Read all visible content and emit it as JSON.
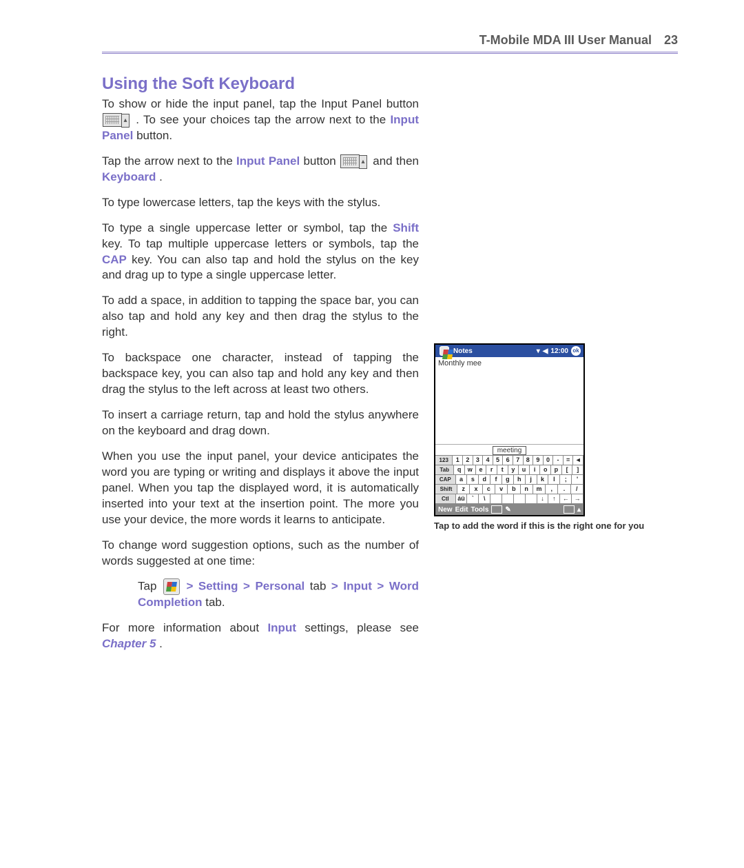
{
  "header": {
    "title": "T-Mobile MDA III User Manual",
    "page_number": "23"
  },
  "section": {
    "title": "Using the Soft Keyboard"
  },
  "para1": {
    "a": "To show or hide the input panel, tap the Input Panel button ",
    "b": ". To see your choices tap the arrow next to the ",
    "kw1": "Input Panel",
    "c": " button."
  },
  "para2": {
    "a": "Tap the arrow next to the ",
    "kw1": "Input Panel",
    "b": " button ",
    "c": " and then ",
    "kw2": "Keyboard",
    "d": "."
  },
  "para3": "To type lowercase letters, tap the keys with the stylus.",
  "para4": {
    "a": "To type a single uppercase letter or symbol, tap the ",
    "kw1": "Shift",
    "b": " key. To tap multiple uppercase letters or symbols, tap the ",
    "kw2": "CAP",
    "c": " key. You can also tap and hold the stylus on the key and drag up to type a single uppercase letter."
  },
  "para5": "To add a space, in addition to tapping the space bar, you can also tap and hold any key and then drag the stylus to the right.",
  "para6": "To backspace one character, instead of tapping the backspace key, you can also tap and hold any key and then drag the stylus to the left across at least two others.",
  "para7": "To insert a carriage return, tap and hold the stylus anywhere on the keyboard and drag down.",
  "para8": "When you use the input panel, your device anticipates the word you are typing or writing and displays it above the input panel. When you tap the displayed word, it is automatically inserted into your text at the insertion point. The more you use your device, the more words it learns to anticipate.",
  "para9": "To change word suggestion options, such as the number of words suggested at one time:",
  "tap_path": {
    "lead": "Tap ",
    "sep": " > ",
    "s1": "Setting",
    "s2": "Personal",
    "tabword": " tab",
    "s3": "Input",
    "s4": "Word Completion",
    "tail": " tab."
  },
  "para10": {
    "a": "For more information about ",
    "kw1": "Input",
    "b": " settings, please see ",
    "ch": "Chapter 5",
    "c": "."
  },
  "phone": {
    "app": "Notes",
    "time": "12:00",
    "ok": "ok",
    "typed": "Monthly mee",
    "suggestion": "meeting",
    "kbd_rows": [
      [
        "123",
        "1",
        "2",
        "3",
        "4",
        "5",
        "6",
        "7",
        "8",
        "9",
        "0",
        "-",
        "=",
        "◄"
      ],
      [
        "Tab",
        "q",
        "w",
        "e",
        "r",
        "t",
        "y",
        "u",
        "i",
        "o",
        "p",
        "[",
        "]"
      ],
      [
        "CAP",
        "a",
        "s",
        "d",
        "f",
        "g",
        "h",
        "j",
        "k",
        "l",
        ";",
        "'"
      ],
      [
        "Shift",
        "z",
        "x",
        "c",
        "v",
        "b",
        "n",
        "m",
        ",",
        ".",
        "/"
      ],
      [
        "Ctl",
        "áü",
        "`",
        "\\",
        "",
        "",
        "",
        "",
        "↓",
        "↑",
        "←",
        "→"
      ]
    ],
    "bottom": {
      "new": "New",
      "edit": "Edit",
      "tools": "Tools"
    }
  },
  "caption": "Tap to add the word if this is the right one for you"
}
